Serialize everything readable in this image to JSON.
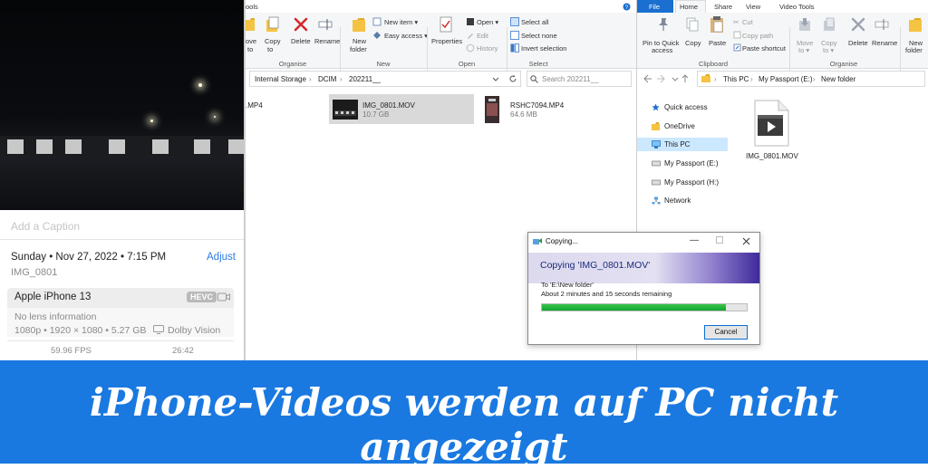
{
  "iphone": {
    "caption_placeholder": "Add a Caption",
    "datetime": "Sunday • Nov 27, 2022 • 7:15 PM",
    "adjust": "Adjust",
    "filename": "IMG_0801",
    "device": "Apple iPhone 13",
    "codec_badge": "HEVC",
    "lens": "No lens information",
    "specs": "1080p • 1920 × 1080 • 5.27 GB",
    "hdr": "Dolby Vision",
    "fps": "59.96 FPS",
    "duration": "26:42"
  },
  "explorer_left": {
    "ribbon_tab_fragment": "ools",
    "buttons": {
      "move_to_a": "ove",
      "move_to_b": "to",
      "copy_to_a": "Copy",
      "copy_to_b": "to",
      "delete": "Delete",
      "rename": "Rename",
      "new_folder_a": "New",
      "new_folder_b": "folder",
      "new_item": "New item ▾",
      "easy_access": "Easy access ▾",
      "properties": "Properties",
      "open": "Open ▾",
      "edit": "Edit",
      "history": "History",
      "select_all": "Select all",
      "select_none": "Select none",
      "invert_selection": "Invert selection"
    },
    "groups": {
      "organise": "Organise",
      "new": "New",
      "open": "Open",
      "select": "Select"
    },
    "breadcrumb": [
      "Internal Storage",
      "DCIM",
      "202211__"
    ],
    "search_placeholder": "Search 202211__",
    "files": [
      {
        "name": ".MP4",
        "size": ""
      },
      {
        "name": "IMG_0801.MOV",
        "size": "10.7 GB"
      },
      {
        "name": "RSHC7094.MP4",
        "size": "64.6 MB"
      }
    ]
  },
  "explorer_right": {
    "tabs": [
      "File",
      "Home",
      "Share",
      "View",
      "Video Tools"
    ],
    "buttons": {
      "pin_a": "Pin to Quick",
      "pin_b": "access",
      "copy": "Copy",
      "paste": "Paste",
      "cut": "Cut",
      "copy_path": "Copy path",
      "paste_shortcut": "Paste shortcut",
      "move_a": "Move",
      "move_b": "to ▾",
      "copy_to_a": "Copy",
      "copy_to_b": "to ▾",
      "delete": "Delete",
      "rename": "Rename",
      "new_a": "New",
      "new_b": "folder"
    },
    "groups": {
      "clipboard": "Clipboard",
      "organise": "Organise"
    },
    "breadcrumb": [
      "This PC",
      "My Passport (E:)",
      "New folder"
    ],
    "nav": [
      "Quick access",
      "OneDrive",
      "This PC",
      "My Passport (E:)",
      "My Passport (H:)",
      "Network"
    ],
    "file": "IMG_0801.MOV"
  },
  "copy_dialog": {
    "title": "Copying...",
    "heading": "Copying 'IMG_0801.MOV'",
    "destination": "To 'E:\\New folder'",
    "remaining": "About 2 minutes and 15 seconds remaining",
    "progress": 0.9,
    "cancel": "Cancel"
  },
  "banner": {
    "title": "iPhone-Videos werden auf PC nicht angezeigt"
  },
  "colors": {
    "banner": "#1a79e0",
    "accent": "#2a7be4",
    "progress": "#14a530",
    "file_tab": "#1a6fd0"
  }
}
